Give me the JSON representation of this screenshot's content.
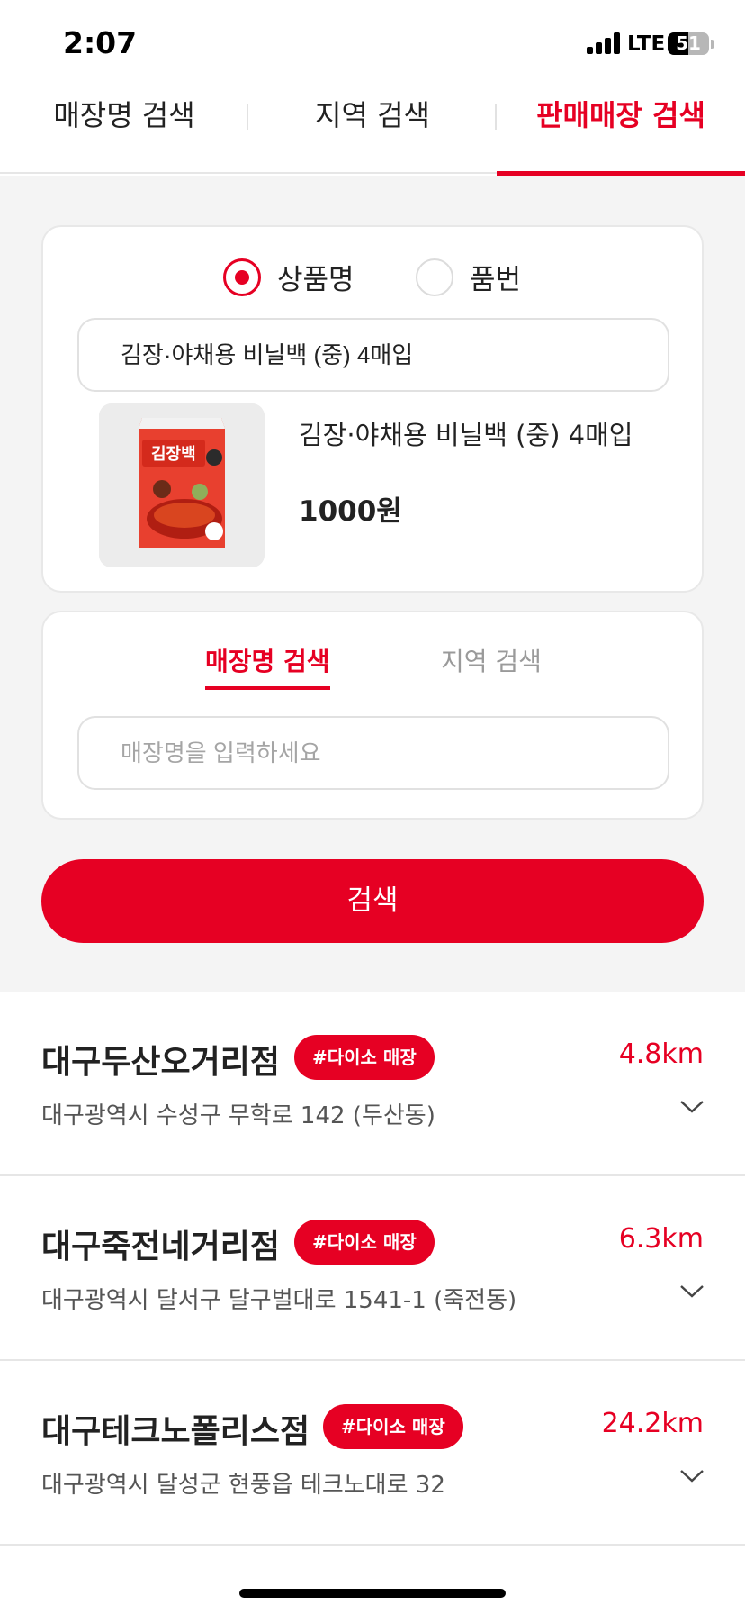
{
  "status_bar": {
    "time": "2:07",
    "network": "LTE",
    "battery": "51",
    "battery_level": 0.51
  },
  "top_tabs": [
    {
      "label": "매장명 검색",
      "active": false
    },
    {
      "label": "지역 검색",
      "active": false
    },
    {
      "label": "판매매장 검색",
      "active": true
    }
  ],
  "product_card": {
    "radios": [
      {
        "label": "상품명",
        "selected": true
      },
      {
        "label": "품번",
        "selected": false
      }
    ],
    "search_value": "김장·야채용 비닐백 (중) 4매입",
    "product_name": "김장·야채용 비닐백 (중) 4매입",
    "product_price": "1000원",
    "thumbnail_icon": "product-package-image"
  },
  "store_card": {
    "tabs": [
      {
        "label": "매장명 검색",
        "active": true
      },
      {
        "label": "지역 검색",
        "active": false
      }
    ],
    "placeholder": "매장명을 입력하세요"
  },
  "search_button": "검색",
  "results": [
    {
      "name": "대구두산오거리점",
      "badge": "#다이소 매장",
      "distance": "4.8km",
      "address": "대구광역시 수성구 무학로 142 (두산동)"
    },
    {
      "name": "대구죽전네거리점",
      "badge": "#다이소 매장",
      "distance": "6.3km",
      "address": "대구광역시 달서구 달구벌대로 1541-1 (죽전동)"
    },
    {
      "name": "대구테크노폴리스점",
      "badge": "#다이소 매장",
      "distance": "24.2km",
      "address": "대구광역시 달성군 현풍읍 테크노대로 32"
    }
  ],
  "colors": {
    "accent": "#e60023",
    "background_gray": "#f4f4f4"
  }
}
